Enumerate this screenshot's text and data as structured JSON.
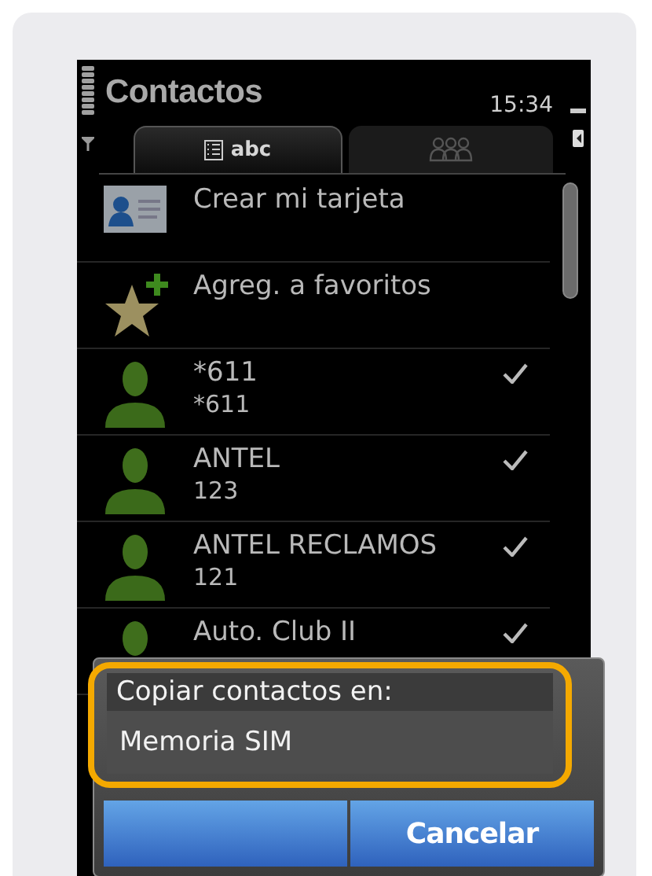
{
  "header": {
    "title": "Contactos",
    "time": "15:34"
  },
  "tabs": [
    {
      "label": "abc",
      "selected": true
    },
    {
      "selected": false
    }
  ],
  "rows": [
    {
      "kind": "card",
      "name": "Crear mi tarjeta"
    },
    {
      "kind": "favorite",
      "name": "Agreg. a favoritos"
    },
    {
      "kind": "contact",
      "name": "*611",
      "number": "*611",
      "checked": true
    },
    {
      "kind": "contact",
      "name": "ANTEL",
      "number": "123",
      "checked": true
    },
    {
      "kind": "contact",
      "name": "ANTEL RECLAMOS",
      "number": "121",
      "checked": true
    },
    {
      "kind": "contact",
      "name": "Auto. Club II",
      "checked": true
    }
  ],
  "dialog": {
    "heading": "Copiar contactos en:",
    "options": [
      {
        "label": "Memoria SIM",
        "highlighted": true
      }
    ],
    "buttons": [
      {
        "label": "Cancelar"
      }
    ]
  }
}
